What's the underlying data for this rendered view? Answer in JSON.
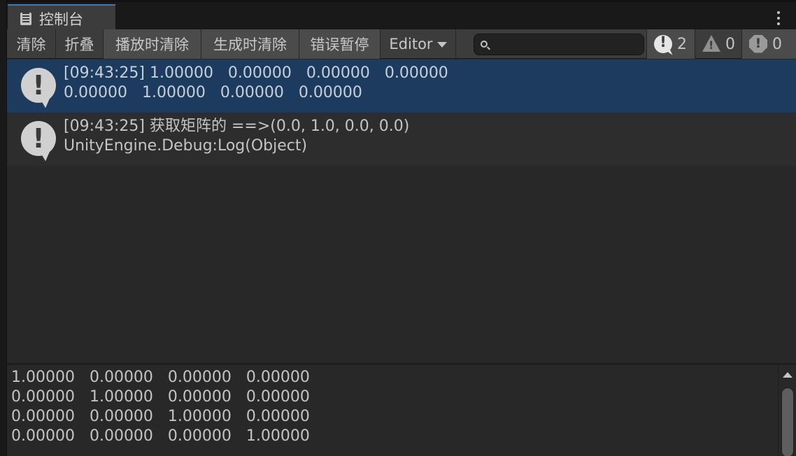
{
  "tab": {
    "title": "控制台"
  },
  "toolbar": {
    "clear": "清除",
    "collapse": "折叠",
    "clear_on_play": "播放时清除",
    "clear_on_build": "生成时清除",
    "error_pause": "错误暂停",
    "editor_dropdown": "Editor",
    "search": {
      "value": "",
      "placeholder": ""
    }
  },
  "counters": {
    "info": "2",
    "warning": "0",
    "error": "0"
  },
  "logs": [
    {
      "type": "info",
      "text": "[09:43:25] 1.00000   0.00000   0.00000   0.00000\n0.00000   1.00000   0.00000   0.00000",
      "selected": true
    },
    {
      "type": "info",
      "text": "[09:43:25] 获取矩阵的 ==>(0.0, 1.0, 0.0, 0.0)\nUnityEngine.Debug:Log(Object)",
      "selected": false
    }
  ],
  "detail": {
    "text": "1.00000   0.00000   0.00000   0.00000\n0.00000   1.00000   0.00000   0.00000\n0.00000   0.00000   1.00000   0.00000\n0.00000   0.00000   0.00000   1.00000"
  },
  "colors": {
    "accent": "#3a79bb",
    "selected_row": "#1d3b5e",
    "panel": "#282828",
    "toolbar": "#3c3c3c"
  },
  "icons": {
    "tab": "console-icon",
    "menu": "kebab-menu-icon",
    "search": "search-icon",
    "info": "info-icon",
    "warning": "warning-icon",
    "error": "error-icon"
  }
}
